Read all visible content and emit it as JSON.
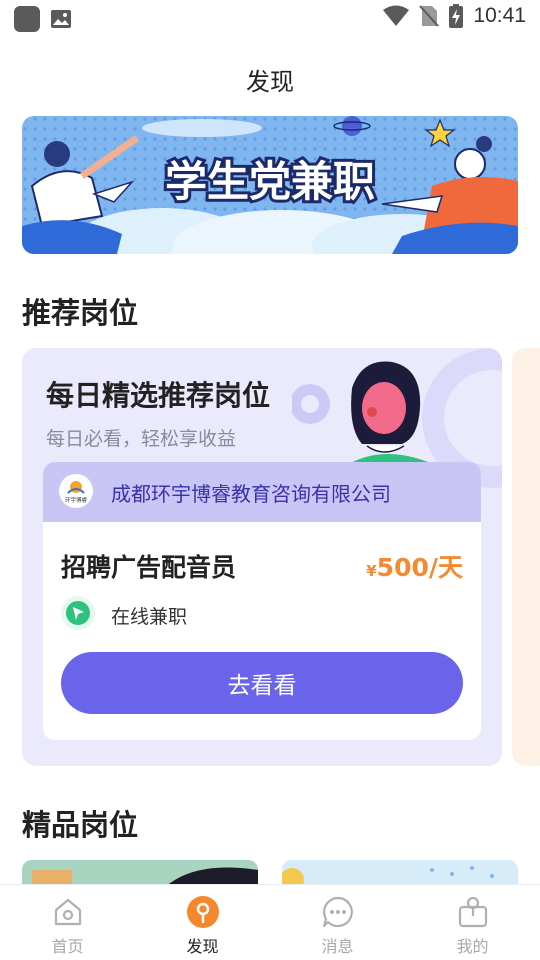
{
  "status_bar": {
    "time": "10:41"
  },
  "page": {
    "title": "发现"
  },
  "banner": {
    "text": "学生党兼职"
  },
  "sections": {
    "recommend": "推荐岗位",
    "quality": "精品岗位"
  },
  "recommend_card": {
    "title": "每日精选推荐岗位",
    "subtitle": "每日必看，轻松享收益",
    "company_logo_text": "环宇博睿",
    "company": "成都环宇博睿教育咨询有限公司",
    "job_title": "招聘广告配音员",
    "salary_symbol": "¥",
    "salary": "500/天",
    "job_type": "在线兼职",
    "button": "去看看"
  },
  "bottom_nav": [
    {
      "label": "首页",
      "icon": "home-icon",
      "active": false
    },
    {
      "label": "发现",
      "icon": "discover-icon",
      "active": true
    },
    {
      "label": "消息",
      "icon": "message-icon",
      "active": false
    },
    {
      "label": "我的",
      "icon": "profile-icon",
      "active": false
    }
  ],
  "colors": {
    "accent": "#6a64ea",
    "salary": "#f48a32",
    "discover_active": "#f7872d",
    "company_bar": "#c9c6f6",
    "card_bg": "#ebeafc"
  }
}
